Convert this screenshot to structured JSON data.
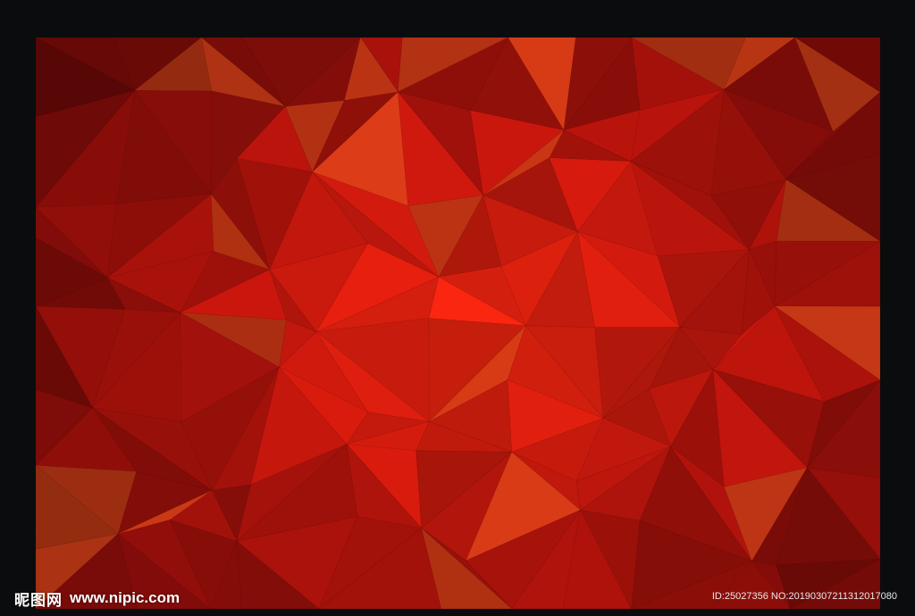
{
  "colors": {
    "frame": "#0a0c0e",
    "center": "#e8250f",
    "mid": "#b8140c",
    "edge": "#5a0706",
    "highlight": "#d9531c"
  },
  "watermark": {
    "logo_cn": "昵图网",
    "url": "www.nipic.com",
    "id_line": "ID:25027356 NO:20190307211312017080"
  }
}
